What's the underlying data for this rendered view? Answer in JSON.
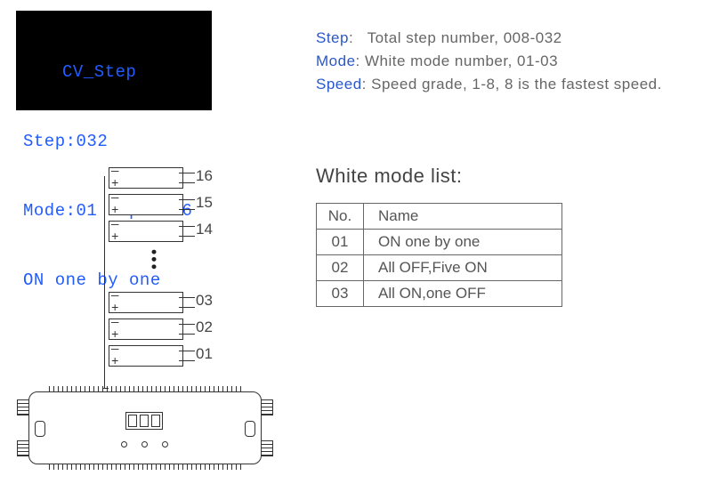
{
  "lcd": {
    "title": "CV_Step",
    "line2": "Step:032",
    "line3": "Mode:01  Speed:6",
    "line4": "ON one by one"
  },
  "definitions": {
    "step": {
      "key": "Step",
      "text": "Total step number, 008-032"
    },
    "mode": {
      "key": "Mode",
      "text": "White mode number, 01-03"
    },
    "speed": {
      "key": "Speed",
      "text": "Speed grade, 1-8, 8 is the fastest speed."
    }
  },
  "white_mode": {
    "title": "White mode list:",
    "headers": {
      "no": "No.",
      "name": "Name"
    },
    "rows": [
      {
        "no": "01",
        "name": "ON one by one"
      },
      {
        "no": "02",
        "name": "All OFF,Five ON"
      },
      {
        "no": "03",
        "name": "All ON,one OFF"
      }
    ]
  },
  "diagram": {
    "ports_top": [
      "16",
      "15",
      "14"
    ],
    "ports_bottom": [
      "03",
      "02",
      "01"
    ],
    "ellipsis": "● ● ●"
  }
}
